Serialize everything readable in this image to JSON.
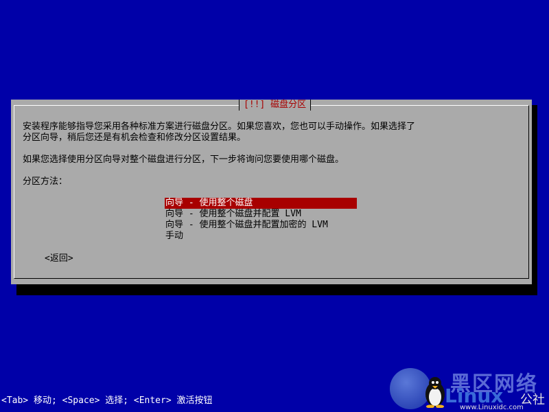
{
  "dialog": {
    "title": "[!!] 磁盘分区",
    "paragraph1": "安装程序能够指导您采用各种标准方案进行磁盘分区。如果您喜欢，您也可以手动操作。如果选择了\n分区向导，稍后您还是有机会检查和修改分区设置结果。",
    "paragraph2": "如果您选择使用分区向导对整个磁盘进行分区，下一步将询问您要使用哪个磁盘。",
    "prompt": "分区方法：",
    "options": [
      {
        "label": "向导 - 使用整个磁盘",
        "selected": true
      },
      {
        "label": "向导 - 使用整个磁盘并配置 LVM",
        "selected": false
      },
      {
        "label": "向导 - 使用整个磁盘并配置加密的 LVM",
        "selected": false
      },
      {
        "label": "手动",
        "selected": false
      }
    ],
    "back_label": "<返回>"
  },
  "hintbar": {
    "text": "<Tab> 移动; <Space> 选择; <Enter> 激活按钮"
  },
  "watermark": {
    "chinese": "黑区网络",
    "brand": "Linux",
    "suffix": "公社",
    "url": "www.Linuxidc.com"
  },
  "colors": {
    "background": "#0000a8",
    "dialog": "#aaaaaa",
    "title": "#a80000",
    "selected": "#a80000"
  },
  "icons": {
    "watermark_logo": "tux-penguin-icon"
  }
}
